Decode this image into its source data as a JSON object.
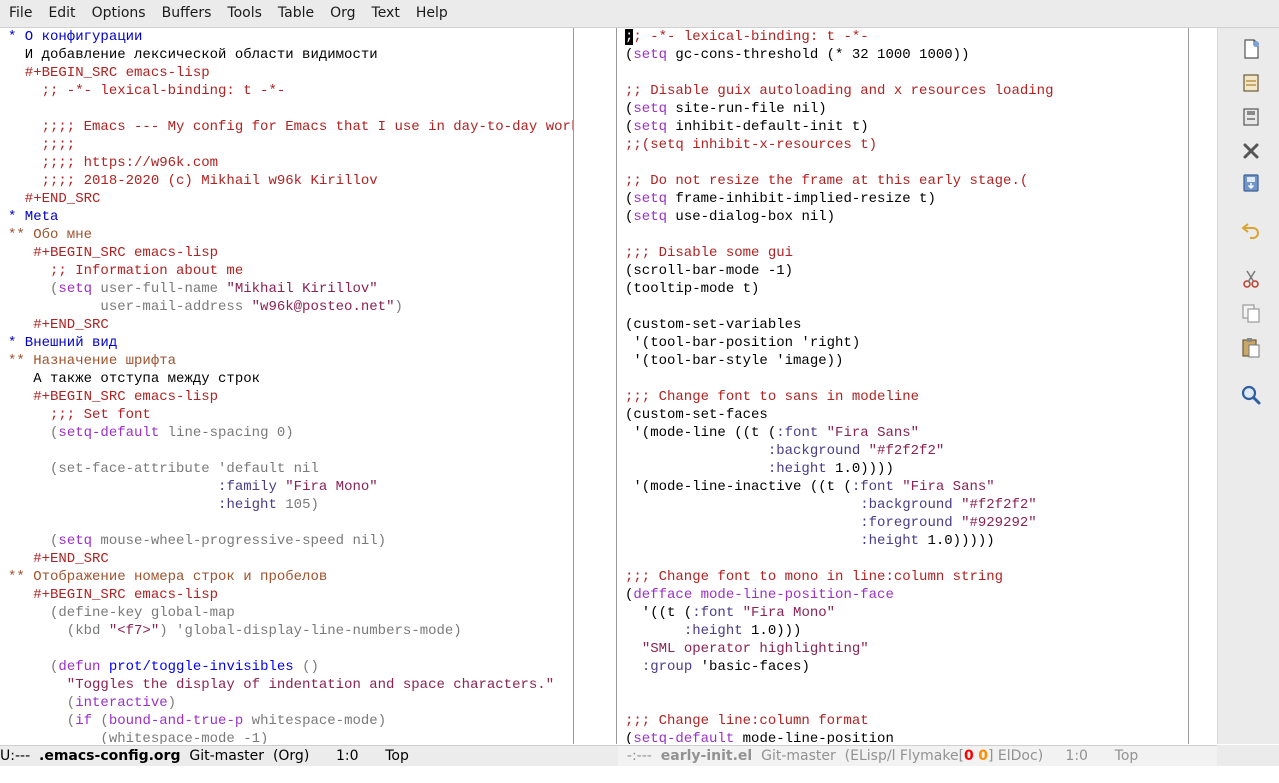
{
  "menubar": [
    "File",
    "Edit",
    "Options",
    "Buffers",
    "Tools",
    "Table",
    "Org",
    "Text",
    "Help"
  ],
  "left_buffer": [
    [
      [
        "h1",
        "* О конфигурации"
      ]
    ],
    [
      [
        "",
        "  И добавление лексической области видимости"
      ]
    ],
    [
      [
        "meta",
        "  #+BEGIN_SRC emacs-lisp"
      ]
    ],
    [
      [
        "cm",
        "    ;; -*- lexical-binding: t -*-"
      ]
    ],
    [
      [
        "",
        ""
      ]
    ],
    [
      [
        "cm",
        "    ;;;; Emacs --- My config for Emacs that I use in day-to-day work"
      ]
    ],
    [
      [
        "cm",
        "    ;;;;"
      ]
    ],
    [
      [
        "cm",
        "    ;;;; https://w96k.com"
      ]
    ],
    [
      [
        "cm",
        "    ;;;; 2018-2020 (c) Mikhail w96k Kirillov"
      ]
    ],
    [
      [
        "meta",
        "  #+END_SRC"
      ]
    ],
    [
      [
        "h1",
        "* Meta"
      ]
    ],
    [
      [
        "h2",
        "** Обо мне"
      ]
    ],
    [
      [
        "meta",
        "   #+BEGIN_SRC emacs-lisp"
      ]
    ],
    [
      [
        "cm",
        "     ;; Information about me"
      ]
    ],
    [
      [
        "gray",
        "     ("
      ],
      [
        "kw",
        "setq"
      ],
      [
        "gray",
        " user-full-name "
      ],
      [
        "str",
        "\"Mikhail Kirillov\""
      ]
    ],
    [
      [
        "gray",
        "           user-mail-address "
      ],
      [
        "str",
        "\"w96k@posteo.net\""
      ],
      [
        "gray",
        ")"
      ]
    ],
    [
      [
        "meta",
        "   #+END_SRC"
      ]
    ],
    [
      [
        "h1",
        "* Внешний вид"
      ]
    ],
    [
      [
        "h2",
        "** Назначение шрифта"
      ]
    ],
    [
      [
        "",
        "   А также отступа между строк"
      ]
    ],
    [
      [
        "meta",
        "   #+BEGIN_SRC emacs-lisp"
      ]
    ],
    [
      [
        "cm",
        "     ;;; Set font"
      ]
    ],
    [
      [
        "gray",
        "     ("
      ],
      [
        "kw",
        "setq-default"
      ],
      [
        "gray",
        " line-spacing 0)"
      ]
    ],
    [
      [
        "",
        ""
      ]
    ],
    [
      [
        "gray",
        "     (set-face-attribute 'default nil"
      ]
    ],
    [
      [
        "gray",
        "                         "
      ],
      [
        "kwc",
        ":family"
      ],
      [
        "gray",
        " "
      ],
      [
        "str",
        "\"Fira Mono\""
      ]
    ],
    [
      [
        "gray",
        "                         "
      ],
      [
        "kwc",
        ":height"
      ],
      [
        "gray",
        " 105)"
      ]
    ],
    [
      [
        "",
        ""
      ]
    ],
    [
      [
        "gray",
        "     ("
      ],
      [
        "kw",
        "setq"
      ],
      [
        "gray",
        " mouse-wheel-progressive-speed nil)"
      ]
    ],
    [
      [
        "meta",
        "   #+END_SRC"
      ]
    ],
    [
      [
        "h2",
        "** Отображение номера строк и пробелов"
      ]
    ],
    [
      [
        "meta",
        "   #+BEGIN_SRC emacs-lisp"
      ]
    ],
    [
      [
        "gray",
        "     (define-key global-map"
      ]
    ],
    [
      [
        "gray",
        "       (kbd "
      ],
      [
        "str",
        "\"<f7>\""
      ],
      [
        "gray",
        ") 'global-display-line-numbers-mode)"
      ]
    ],
    [
      [
        "",
        ""
      ]
    ],
    [
      [
        "gray",
        "     ("
      ],
      [
        "kw",
        "defun"
      ],
      [
        "gray",
        " "
      ],
      [
        "fn",
        "prot/toggle-invisibles"
      ],
      [
        "gray",
        " ()"
      ]
    ],
    [
      [
        "str",
        "       \"Toggles the display of indentation and space characters.\""
      ]
    ],
    [
      [
        "gray",
        "       ("
      ],
      [
        "kw",
        "interactive"
      ],
      [
        "gray",
        ")"
      ]
    ],
    [
      [
        "gray",
        "       ("
      ],
      [
        "kw",
        "if"
      ],
      [
        "gray",
        " ("
      ],
      [
        "kw",
        "bound-and-true-p"
      ],
      [
        "gray",
        " whitespace-mode)"
      ]
    ],
    [
      [
        "gray",
        "           (whitespace-mode -1)"
      ]
    ]
  ],
  "right_buffer": [
    [
      [
        "cursor",
        ";"
      ],
      [
        "cm",
        "; -*- lexical-binding: t -*-"
      ]
    ],
    [
      [
        "",
        "("
      ],
      [
        "kw",
        "setq"
      ],
      [
        "",
        " gc-cons-threshold (* 32 1000 1000))"
      ]
    ],
    [
      [
        "",
        ""
      ]
    ],
    [
      [
        "cm",
        ";; Disable guix autoloading and x resources loading"
      ]
    ],
    [
      [
        "",
        "("
      ],
      [
        "kw",
        "setq"
      ],
      [
        "",
        " site-run-file nil)"
      ]
    ],
    [
      [
        "",
        "("
      ],
      [
        "kw",
        "setq"
      ],
      [
        "",
        " inhibit-default-init t)"
      ]
    ],
    [
      [
        "cm",
        ";;(setq inhibit-x-resources t)"
      ]
    ],
    [
      [
        "",
        ""
      ]
    ],
    [
      [
        "cm",
        ";; Do not resize the frame at this early stage.("
      ]
    ],
    [
      [
        "",
        "("
      ],
      [
        "kw",
        "setq"
      ],
      [
        "",
        " frame-inhibit-implied-resize t)"
      ]
    ],
    [
      [
        "",
        "("
      ],
      [
        "kw",
        "setq"
      ],
      [
        "",
        " use-dialog-box nil)"
      ]
    ],
    [
      [
        "",
        ""
      ]
    ],
    [
      [
        "cm",
        ";;; Disable some gui"
      ]
    ],
    [
      [
        "",
        "(scroll-bar-mode -1)"
      ]
    ],
    [
      [
        "",
        "(tooltip-mode t)"
      ]
    ],
    [
      [
        "",
        ""
      ]
    ],
    [
      [
        "",
        "(custom-set-variables"
      ]
    ],
    [
      [
        "",
        " '(tool-bar-position 'right)"
      ]
    ],
    [
      [
        "",
        " '(tool-bar-style 'image))"
      ]
    ],
    [
      [
        "",
        ""
      ]
    ],
    [
      [
        "cm",
        ";;; Change font to sans in modeline"
      ]
    ],
    [
      [
        "",
        "(custom-set-faces"
      ]
    ],
    [
      [
        "",
        " '(mode-line ((t ("
      ],
      [
        "kwc",
        ":font"
      ],
      [
        "",
        " "
      ],
      [
        "str",
        "\"Fira Sans\""
      ]
    ],
    [
      [
        "",
        "                 "
      ],
      [
        "kwc",
        ":background"
      ],
      [
        "",
        " "
      ],
      [
        "str",
        "\"#f2f2f2\""
      ]
    ],
    [
      [
        "",
        "                 "
      ],
      [
        "kwc",
        ":height"
      ],
      [
        "",
        " 1.0))))"
      ]
    ],
    [
      [
        "",
        " '(mode-line-inactive ((t ("
      ],
      [
        "kwc",
        ":font"
      ],
      [
        "",
        " "
      ],
      [
        "str",
        "\"Fira Sans\""
      ]
    ],
    [
      [
        "",
        "                            "
      ],
      [
        "kwc",
        ":background"
      ],
      [
        "",
        " "
      ],
      [
        "str",
        "\"#f2f2f2\""
      ]
    ],
    [
      [
        "",
        "                            "
      ],
      [
        "kwc",
        ":foreground"
      ],
      [
        "",
        " "
      ],
      [
        "str",
        "\"#929292\""
      ]
    ],
    [
      [
        "",
        "                            "
      ],
      [
        "kwc",
        ":height"
      ],
      [
        "",
        " 1.0)))))"
      ]
    ],
    [
      [
        "",
        ""
      ]
    ],
    [
      [
        "cm",
        ";;; Change font to mono in line:column string"
      ]
    ],
    [
      [
        "",
        "("
      ],
      [
        "kw",
        "defface"
      ],
      [
        "",
        " "
      ],
      [
        "kw",
        "mode-line-position-face"
      ]
    ],
    [
      [
        "",
        "  '((t ("
      ],
      [
        "kwc",
        ":font"
      ],
      [
        "",
        " "
      ],
      [
        "str",
        "\"Fira Mono\""
      ]
    ],
    [
      [
        "",
        "       "
      ],
      [
        "kwc",
        ":height"
      ],
      [
        "",
        " 1.0)))"
      ]
    ],
    [
      [
        "",
        "  "
      ],
      [
        "str",
        "\"SML operator highlighting\""
      ]
    ],
    [
      [
        "",
        "  "
      ],
      [
        "kwc",
        ":group"
      ],
      [
        "",
        " 'basic-faces)"
      ]
    ],
    [
      [
        "",
        ""
      ]
    ],
    [
      [
        "",
        ""
      ]
    ],
    [
      [
        "cm",
        ";;; Change line:column format"
      ]
    ],
    [
      [
        "",
        "("
      ],
      [
        "kw",
        "setq-default"
      ],
      [
        "",
        " mode-line-position"
      ]
    ]
  ],
  "modeline_left": {
    "state": "U:---",
    "buffer": ".emacs-config.org",
    "vc": "Git-master",
    "mode": "(Org)",
    "pos": "1:0",
    "scroll": "Top"
  },
  "modeline_right": {
    "state": "-:---",
    "buffer": "early-init.el",
    "vc": "Git-master",
    "mode_prefix": "(ELisp/l Flymake[",
    "err": "0",
    "warn": "0",
    "mode_suffix": "] ElDoc)",
    "pos": "1:0",
    "scroll": "Top"
  },
  "toolbar": [
    "new-file-icon",
    "open-folder-icon",
    "save-icon",
    "close-icon",
    "save-as-icon",
    "undo-icon",
    "cut-icon",
    "copy-icon",
    "paste-icon",
    "search-icon"
  ]
}
